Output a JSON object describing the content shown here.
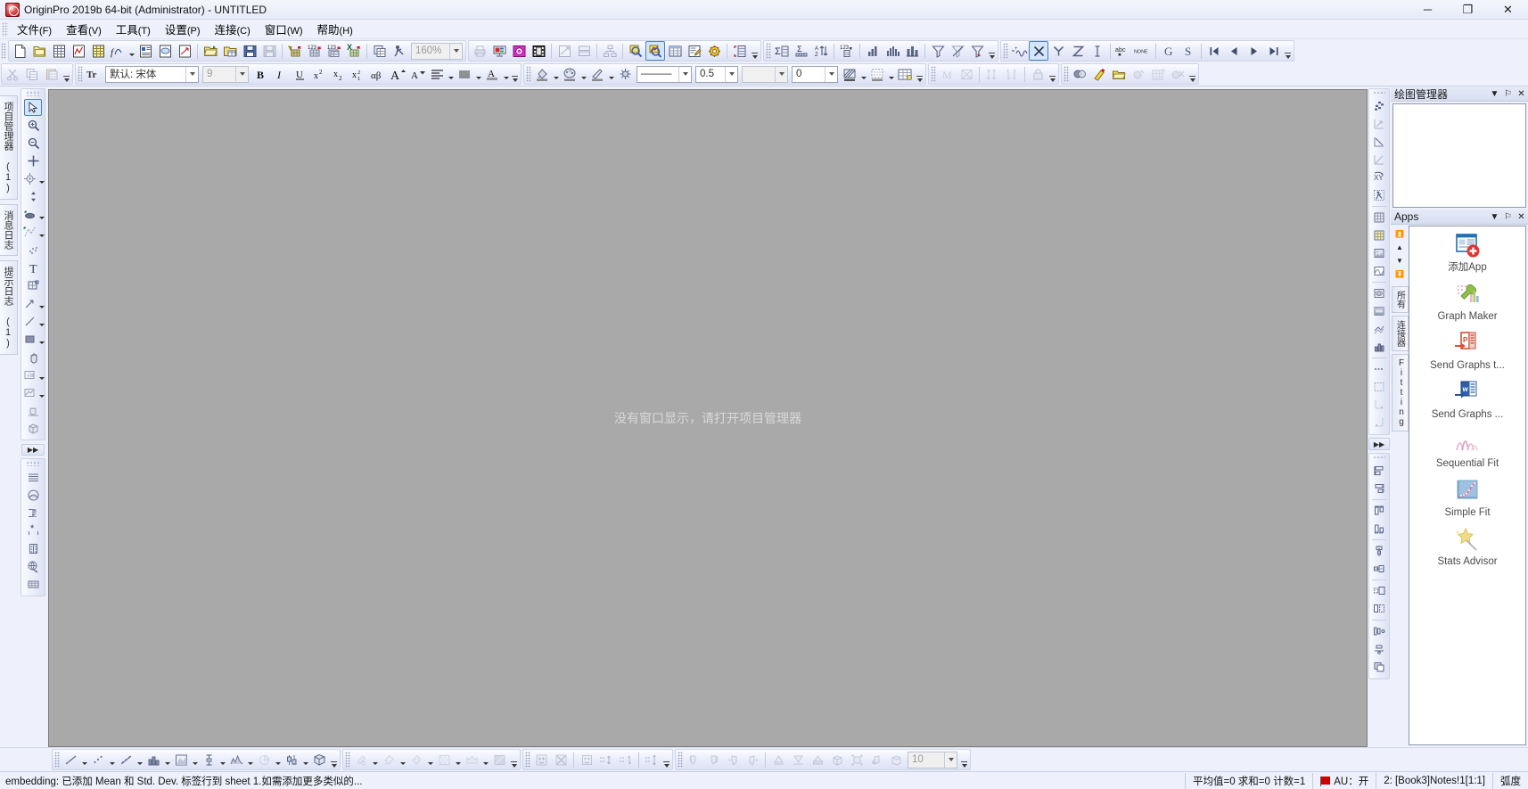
{
  "window": {
    "title": "OriginPro 2019b 64-bit (Administrator) - UNTITLED",
    "app_icon": "origin-logo-icon",
    "minimize": "─",
    "maximize": "❐",
    "close": "✕"
  },
  "menu": [
    {
      "label": "文件",
      "mnemonic": "(F)",
      "name": "menu-file"
    },
    {
      "label": "查看",
      "mnemonic": "(V)",
      "name": "menu-view"
    },
    {
      "label": "工具",
      "mnemonic": "(T)",
      "name": "menu-tools"
    },
    {
      "label": "设置",
      "mnemonic": "(P)",
      "name": "menu-preferences"
    },
    {
      "label": "连接",
      "mnemonic": "(C)",
      "name": "menu-connectivity"
    },
    {
      "label": "窗口",
      "mnemonic": "(W)",
      "name": "menu-window"
    },
    {
      "label": "帮助",
      "mnemonic": "(H)",
      "name": "menu-help"
    }
  ],
  "toolbar_std": {
    "zoom_value": "160%",
    "items": [
      "new-project-icon",
      "new-folder-icon",
      "new-workbook-icon",
      "new-graph-icon",
      "new-matrix-icon",
      "new-function-plot-icon",
      "new-layout-icon",
      "new-notes-icon",
      "new-excel-icon",
      "open-icon",
      "open-excel-icon",
      "save-project-icon",
      "save-template-icon",
      "import-wizard-icon",
      "import-single-ascii-icon",
      "import-multiple-ascii-icon",
      "import-excel-icon",
      "duplicate-icon",
      "refresh-icon"
    ]
  },
  "toolbar_graph": {
    "items": [
      "print-icon",
      "slide-show-icon",
      "send-graph-icon",
      "movie-icon",
      "layer-management-icon",
      "merge-graph-icon",
      "extract-layers-icon",
      "zoom-in-icon",
      "zoom-out-icon",
      "data-display-icon",
      "results-log-icon",
      "gear-icon",
      "add-layer-icon"
    ]
  },
  "toolbar_analysis": {
    "items": [
      "statistics-icon",
      "stat-columns-icon",
      "sort-worksheet-icon",
      "set-column-values-icon",
      "bar-chart-icon",
      "histogram-icon",
      "column-plot-icon",
      "filter-icon",
      "clear-filter-icon",
      "reapply-filter-icon"
    ]
  },
  "toolbar_column": {
    "items": [
      "set-as-error-icon",
      "set-as-x-icon",
      "set-as-y-icon",
      "set-as-z-icon",
      "set-as-label-icon",
      "set-as-abc-icon",
      "set-as-none-icon",
      "group-icon",
      "set-as-subject-icon",
      "first-column-icon",
      "prev-column-icon",
      "next-column-icon",
      "last-column-icon"
    ]
  },
  "toolbar_format": {
    "font_name": "默认: 宋体",
    "font_size": "9",
    "bold": "B",
    "italic": "I",
    "underline": "U",
    "superscript": "x²",
    "subscript": "x₂",
    "supersub": "x²₁",
    "greek": "αβ",
    "increase_font": "A",
    "decrease_font": "A",
    "items": [
      "cut-icon",
      "copy-icon",
      "paste-icon",
      "align-icon",
      "vertical-lines-icon",
      "text-color-icon"
    ]
  },
  "toolbar_style": {
    "line_style": "———",
    "line_width": "0.5",
    "fill_color": "",
    "transparency": "0",
    "items": [
      "fill-color-icon",
      "palette-icon",
      "line-color-icon",
      "brightness-icon",
      "pattern-icon",
      "grid-pattern-icon",
      "table-style-icon"
    ]
  },
  "toolbar_object": {
    "items": [
      "merge-cells-icon",
      "unmerge-cells-icon",
      "vertical-spacing-icon",
      "horizontal-spacing-icon",
      "lock-icon"
    ]
  },
  "toolbar_mask": {
    "items": [
      "mask-points-icon",
      "highlight-icon",
      "open-mask-icon",
      "hide-mask-icon",
      "mask-worksheet-icon",
      "remove-mask-icon"
    ]
  },
  "left_tabs": [
    {
      "label": "项目管理器 (1)",
      "name": "vtab-project-manager"
    },
    {
      "label": "消息日志",
      "name": "vtab-message-log"
    },
    {
      "label": "提示日志 (1)",
      "name": "vtab-hints-log"
    }
  ],
  "left_tools_top": [
    "pointer-icon",
    "zoom-in-tool-icon",
    "zoom-out-tool-icon",
    "data-reader-icon",
    "screen-reader-icon",
    "data-selector-icon",
    "draw-data-icon",
    "regional-mask-icon",
    "scatter-icon",
    "text-tool-icon",
    "legend-tool-icon",
    "arrow-tool-icon",
    "line-tool-icon",
    "rectangle-tool-icon",
    "pan-tool-icon",
    "equation-tool-icon",
    "region-tool-icon"
  ],
  "left_tools_bottom": [
    "new-layer-icon",
    "arrange-layers-icon",
    "add-object-icon",
    "sphere-icon",
    "b-to-c-icon",
    "asterisk-icon",
    "column-scale-icon",
    "global-icon",
    "layer-icon"
  ],
  "right_tools_top": [
    "mask-pattern-icon",
    "axis-ticks-icon",
    "line-slope-icon",
    "axis-scale-icon",
    "xy-swap-icon",
    "run-script-icon",
    "grid-icon",
    "matrix-icon",
    "image-icon",
    "profile-icon",
    "contour-icon",
    "colormap-icon",
    "surface-icon",
    "3d-bars-icon",
    "dash-icon",
    "speed-icon",
    "frame-icon",
    "axis-left-icon",
    "axis-right-icon"
  ],
  "right_tools_bottom": [
    "align-left-icon",
    "align-right-icon",
    "align-top-icon",
    "align-bottom-icon",
    "align-center-h-icon",
    "align-center-v-icon",
    "size-match-icon",
    "size-width-icon",
    "distribute-h-icon",
    "distribute-v-icon",
    "bring-front-icon",
    "send-back-icon",
    "group-objects-icon",
    "ungroup-objects-icon"
  ],
  "plot_manager": {
    "title": "绘图管理器",
    "dropdown": "▼",
    "pin": "⚐",
    "close": "✕"
  },
  "apps_panel": {
    "title": "Apps",
    "dropdown": "▼",
    "pin": "⚐",
    "close": "✕",
    "nav": [
      "scroll-top-icon",
      "scroll-up-icon",
      "scroll-down-icon",
      "scroll-bottom-icon"
    ],
    "tabs": [
      {
        "label": "所有",
        "name": "apps-tab-all"
      },
      {
        "label": "连接器",
        "name": "apps-tab-connector"
      },
      {
        "label": "Fitting",
        "name": "apps-tab-fitting"
      }
    ],
    "items": [
      {
        "label": "添加App",
        "icon": "add-app-icon",
        "name": "app-add-app"
      },
      {
        "label": "Graph Maker",
        "icon": "graph-maker-icon",
        "name": "app-graph-maker"
      },
      {
        "label": "Send Graphs t...",
        "icon": "send-graphs-powerpoint-icon",
        "name": "app-send-graphs-to-powerpoint"
      },
      {
        "label": "Send Graphs ...",
        "icon": "send-graphs-word-icon",
        "name": "app-send-graphs-to-word"
      },
      {
        "label": "Sequential Fit",
        "icon": "sequential-fit-icon",
        "name": "app-sequential-fit"
      },
      {
        "label": "Simple Fit",
        "icon": "simple-fit-icon",
        "name": "app-simple-fit"
      },
      {
        "label": "Stats Advisor",
        "icon": "stats-advisor-icon",
        "name": "app-stats-advisor"
      }
    ]
  },
  "mdi": {
    "empty_message": "没有窗口显示，请打开项目管理器"
  },
  "bottom_toolbar_style": {
    "items": [
      "line-style-icon",
      "scatter-style-icon",
      "line-symbol-icon",
      "column-style-icon",
      "area-style-icon",
      "error-bar-icon",
      "peak-icon",
      "pie-icon",
      "floating-bar-icon",
      "3d-style-icon"
    ]
  },
  "bottom_toolbar_fill": {
    "items": [
      "fill-pattern-icon",
      "fill-color2-icon",
      "fill-gradient-icon",
      "fill-texture-icon",
      "fill-crown-icon",
      "fill-solid-icon"
    ]
  },
  "bottom_toolbar_mask2": {
    "items": [
      "mask-face-icon",
      "mask-cross-icon",
      "mask-single-icon",
      "grid-expand-v-icon",
      "grid-expand-h-icon",
      "grid-expand-icon"
    ]
  },
  "bottom_toolbar_3d": {
    "value": "10",
    "items": [
      "rotate-left-icon",
      "rotate-right-icon",
      "tilt-left-icon",
      "tilt-right-icon",
      "perspective-up-icon",
      "perspective-down-icon",
      "projection-icon",
      "box-icon",
      "resize-3d-icon",
      "rotate-3d-icon",
      "fly-3d-icon"
    ]
  },
  "status_bar": {
    "message": "embedding: 已添加 Mean 和 Std. Dev. 标签行到 sheet 1.如需添加更多类似的...",
    "stats": "平均值=0 求和=0 计数=1",
    "au_label": "AU：开",
    "selection": "2: [Book3]Notes!1[1:1]",
    "angle_unit": "弧度"
  },
  "colors": {
    "chrome": "#eef1fb",
    "mdi_bg": "#a9a9a9",
    "mdi_text": "#d9d9d9",
    "accent_select": "#4a7fbd",
    "red": "#cc0000",
    "status_text": "#111111"
  }
}
